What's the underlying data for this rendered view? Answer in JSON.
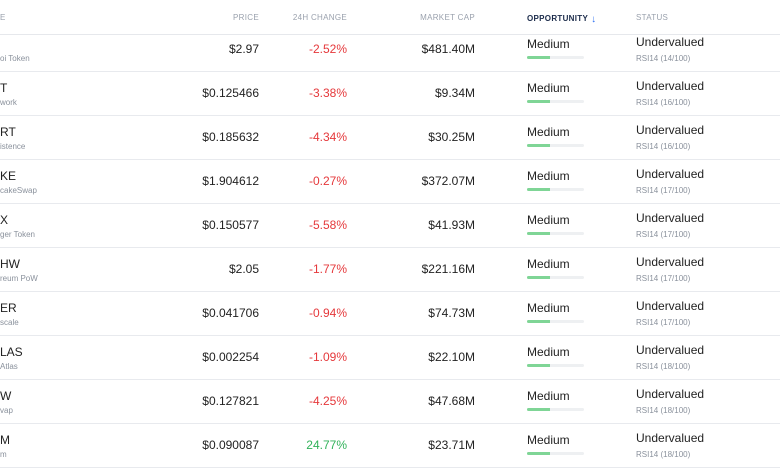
{
  "header": {
    "col_name": "E",
    "col_price": "PRICE",
    "col_change": "24H CHANGE",
    "col_mcap": "MARKET CAP",
    "col_opportunity": "OPPORTUNITY",
    "col_opportunity_sort_icon": "↓",
    "col_status": "STATUS"
  },
  "colors": {
    "negative": "#e5383b",
    "positive": "#31b25a",
    "bar": "#7fd596",
    "sort_arrow": "#2b6ff2"
  },
  "rows": [
    {
      "symbol": "",
      "name": "oi Token",
      "price": "$2.97",
      "change": "-2.52%",
      "dir": "neg",
      "mcap": "$481.40M",
      "opportunity": "Medium",
      "opp_level": 0.4,
      "status": "Undervalued",
      "rsi": "RSI14 (14/100)"
    },
    {
      "symbol": "T",
      "name": "work",
      "price": "$0.125466",
      "change": "-3.38%",
      "dir": "neg",
      "mcap": "$9.34M",
      "opportunity": "Medium",
      "opp_level": 0.4,
      "status": "Undervalued",
      "rsi": "RSI14 (16/100)"
    },
    {
      "symbol": "RT",
      "name": "istence",
      "price": "$0.185632",
      "change": "-4.34%",
      "dir": "neg",
      "mcap": "$30.25M",
      "opportunity": "Medium",
      "opp_level": 0.4,
      "status": "Undervalued",
      "rsi": "RSI14 (16/100)"
    },
    {
      "symbol": "KE",
      "name": "cakeSwap",
      "price": "$1.904612",
      "change": "-0.27%",
      "dir": "neg",
      "mcap": "$372.07M",
      "opportunity": "Medium",
      "opp_level": 0.4,
      "status": "Undervalued",
      "rsi": "RSI14 (17/100)"
    },
    {
      "symbol": "X",
      "name": "ger Token",
      "price": "$0.150577",
      "change": "-5.58%",
      "dir": "neg",
      "mcap": "$41.93M",
      "opportunity": "Medium",
      "opp_level": 0.4,
      "status": "Undervalued",
      "rsi": "RSI14 (17/100)"
    },
    {
      "symbol": "HW",
      "name": "reum PoW",
      "price": "$2.05",
      "change": "-1.77%",
      "dir": "neg",
      "mcap": "$221.16M",
      "opportunity": "Medium",
      "opp_level": 0.4,
      "status": "Undervalued",
      "rsi": "RSI14 (17/100)"
    },
    {
      "symbol": "ER",
      "name": "scale",
      "price": "$0.041706",
      "change": "-0.94%",
      "dir": "neg",
      "mcap": "$74.73M",
      "opportunity": "Medium",
      "opp_level": 0.4,
      "status": "Undervalued",
      "rsi": "RSI14 (17/100)"
    },
    {
      "symbol": "LAS",
      "name": "Atlas",
      "price": "$0.002254",
      "change": "-1.09%",
      "dir": "neg",
      "mcap": "$22.10M",
      "opportunity": "Medium",
      "opp_level": 0.4,
      "status": "Undervalued",
      "rsi": "RSI14 (18/100)"
    },
    {
      "symbol": "W",
      "name": "vap",
      "price": "$0.127821",
      "change": "-4.25%",
      "dir": "neg",
      "mcap": "$47.68M",
      "opportunity": "Medium",
      "opp_level": 0.4,
      "status": "Undervalued",
      "rsi": "RSI14 (18/100)"
    },
    {
      "symbol": "M",
      "name": "m",
      "price": "$0.090087",
      "change": "24.77%",
      "dir": "pos",
      "mcap": "$23.71M",
      "opportunity": "Medium",
      "opp_level": 0.4,
      "status": "Undervalued",
      "rsi": "RSI14 (18/100)"
    }
  ]
}
